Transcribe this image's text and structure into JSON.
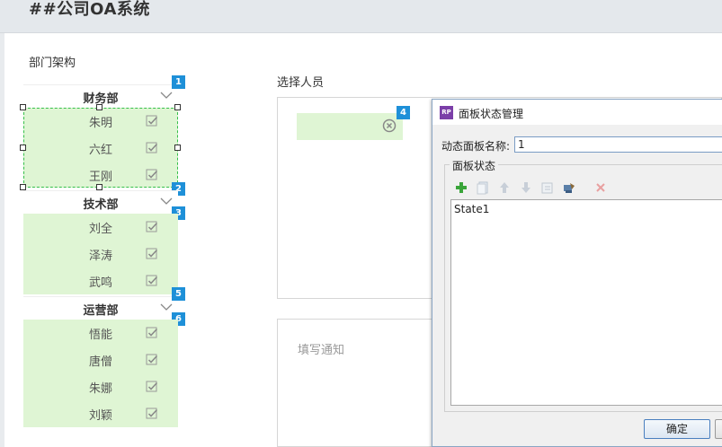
{
  "app": {
    "title": "##公司OA系统"
  },
  "department": {
    "title": "部门架构",
    "groups": [
      {
        "name": "财务部",
        "header_badge": "1",
        "body_badge": "2",
        "members": [
          "朱明",
          "六红",
          "王刚"
        ]
      },
      {
        "name": "技术部",
        "header_badge": "3",
        "body_badge": "",
        "members": [
          "刘全",
          "泽涛",
          "武鸣"
        ]
      },
      {
        "name": "运营部",
        "header_badge": "5",
        "body_badge": "6",
        "members": [
          "悟能",
          "唐僧",
          "朱娜",
          "刘颖"
        ]
      }
    ]
  },
  "picker": {
    "title": "选择人员",
    "chip_badge": "4"
  },
  "notice": {
    "placeholder": "填写通知"
  },
  "dialog": {
    "logo": "RP",
    "title": "面板状态管理",
    "name_label": "动态面板名称:",
    "name_value": "1",
    "group_label": "面板状态",
    "states": [
      "State1"
    ],
    "ok_label": "确定"
  },
  "colors": {
    "accent_badge": "#1e90d8",
    "member_bg": "#dff5d4",
    "selection": "#35c04a",
    "add_icon": "#3aa53a",
    "delete_icon": "#e05555"
  }
}
